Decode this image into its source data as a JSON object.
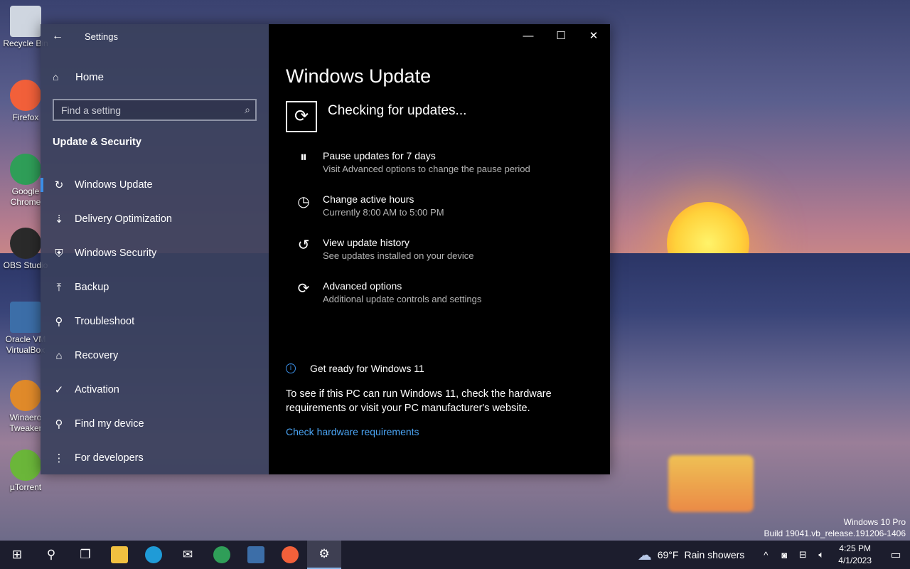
{
  "desktop": {
    "icons": [
      {
        "label": "Recycle Bin",
        "color": "#cfd6e0"
      },
      {
        "label": "Firefox",
        "color": "#f2603a"
      },
      {
        "label": "Google Chrome",
        "color": "#2f9e58"
      },
      {
        "label": "OBS Studio",
        "color": "#2a2a2a"
      },
      {
        "label": "Oracle VM VirtualBox",
        "color": "#3c6ea8"
      },
      {
        "label": "Winaero Tweaker",
        "color": "#e08a2a"
      },
      {
        "label": "µTorrent",
        "color": "#6bb63a"
      }
    ],
    "watermark_line1": "Windows 10 Pro",
    "watermark_line2": "Build 19041.vb_release.191206-1406"
  },
  "window": {
    "title": "Settings",
    "back_glyph": "←",
    "home_label": "Home",
    "search_placeholder": "Find a setting",
    "section_title": "Update & Security",
    "nav": [
      {
        "label": "Windows Update",
        "icon": "↻",
        "active": true
      },
      {
        "label": "Delivery Optimization",
        "icon": "⇣"
      },
      {
        "label": "Windows Security",
        "icon": "⛨"
      },
      {
        "label": "Backup",
        "icon": "⤒"
      },
      {
        "label": "Troubleshoot",
        "icon": "⚲"
      },
      {
        "label": "Recovery",
        "icon": "⌂"
      },
      {
        "label": "Activation",
        "icon": "✓"
      },
      {
        "label": "Find my device",
        "icon": "⚲"
      },
      {
        "label": "For developers",
        "icon": "⋮"
      }
    ],
    "minimize_glyph": "—",
    "maximize_glyph": "☐",
    "close_glyph": "✕",
    "page_title": "Windows Update",
    "status": "Checking for updates...",
    "options": [
      {
        "title": "Pause updates for 7 days",
        "subtitle": "Visit Advanced options to change the pause period",
        "icon": "⏸"
      },
      {
        "title": "Change active hours",
        "subtitle": "Currently 8:00 AM to 5:00 PM",
        "icon": "◷"
      },
      {
        "title": "View update history",
        "subtitle": "See updates installed on your device",
        "icon": "↺"
      },
      {
        "title": "Advanced options",
        "subtitle": "Additional update controls and settings",
        "icon": "⟳"
      }
    ],
    "win11_title": "Get ready for Windows 11",
    "win11_text": "To see if this PC can run Windows 11, check the hardware requirements or visit your PC manufacturer's website.",
    "win11_link": "Check hardware requirements"
  },
  "taskbar": {
    "weather_temp": "69°F",
    "weather_desc": "Rain showers",
    "time": "4:25 PM",
    "date": "4/1/2023",
    "chevron": "^"
  }
}
